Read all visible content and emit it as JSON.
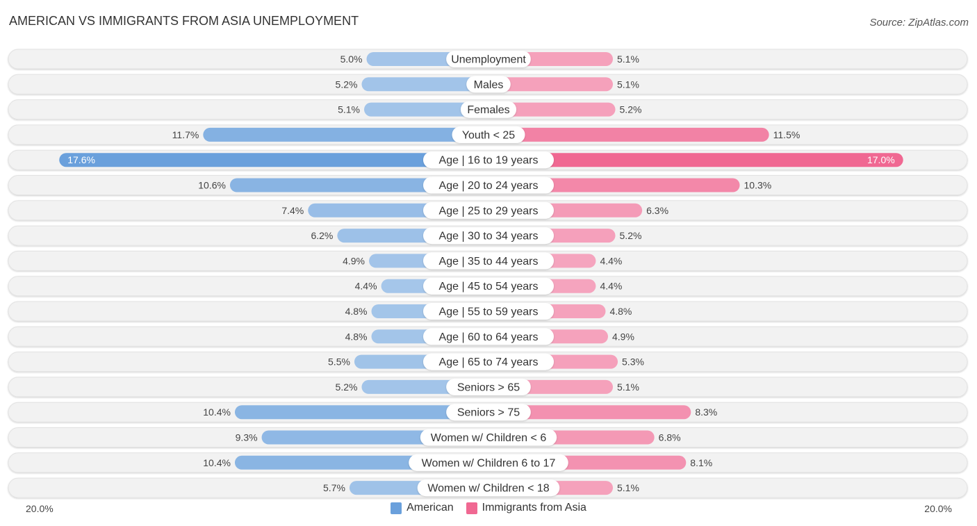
{
  "title": "AMERICAN VS IMMIGRANTS FROM ASIA UNEMPLOYMENT",
  "source": "Source: ZipAtlas.com",
  "colors": {
    "american": "#6aa0dc",
    "american_light": "#a7c7ea",
    "immigrants": "#f06892",
    "immigrants_light": "#f5a6bf",
    "row_bg": "#f2f2f2"
  },
  "chart_data": {
    "type": "bar",
    "orientation": "horizontal-diverging",
    "title": "AMERICAN VS IMMIGRANTS FROM ASIA UNEMPLOYMENT",
    "xlabel": "",
    "ylabel": "",
    "xlim": [
      -20,
      20
    ],
    "axis_labels": {
      "left": "20.0%",
      "right": "20.0%"
    },
    "legend": {
      "position": "bottom-center",
      "entries": [
        "American",
        "Immigrants from Asia"
      ]
    },
    "categories": [
      "Unemployment",
      "Males",
      "Females",
      "Youth < 25",
      "Age | 16 to 19 years",
      "Age | 20 to 24 years",
      "Age | 25 to 29 years",
      "Age | 30 to 34 years",
      "Age | 35 to 44 years",
      "Age | 45 to 54 years",
      "Age | 55 to 59 years",
      "Age | 60 to 64 years",
      "Age | 65 to 74 years",
      "Seniors > 65",
      "Seniors > 75",
      "Women w/ Children < 6",
      "Women w/ Children 6 to 17",
      "Women w/ Children < 18"
    ],
    "series": [
      {
        "name": "American",
        "values": [
          5.0,
          5.2,
          5.1,
          11.7,
          17.6,
          10.6,
          7.4,
          6.2,
          4.9,
          4.4,
          4.8,
          4.8,
          5.5,
          5.2,
          10.4,
          9.3,
          10.4,
          5.7
        ],
        "labels": [
          "5.0%",
          "5.2%",
          "5.1%",
          "11.7%",
          "17.6%",
          "10.6%",
          "7.4%",
          "6.2%",
          "4.9%",
          "4.4%",
          "4.8%",
          "4.8%",
          "5.5%",
          "5.2%",
          "10.4%",
          "9.3%",
          "10.4%",
          "5.7%"
        ]
      },
      {
        "name": "Immigrants from Asia",
        "values": [
          5.1,
          5.1,
          5.2,
          11.5,
          17.0,
          10.3,
          6.3,
          5.2,
          4.4,
          4.4,
          4.8,
          4.9,
          5.3,
          5.1,
          8.3,
          6.8,
          8.1,
          5.1
        ],
        "labels": [
          "5.1%",
          "5.1%",
          "5.2%",
          "11.5%",
          "17.0%",
          "10.3%",
          "6.3%",
          "5.2%",
          "4.4%",
          "4.4%",
          "4.8%",
          "4.9%",
          "5.3%",
          "5.1%",
          "8.3%",
          "6.8%",
          "8.1%",
          "5.1%"
        ]
      }
    ]
  }
}
